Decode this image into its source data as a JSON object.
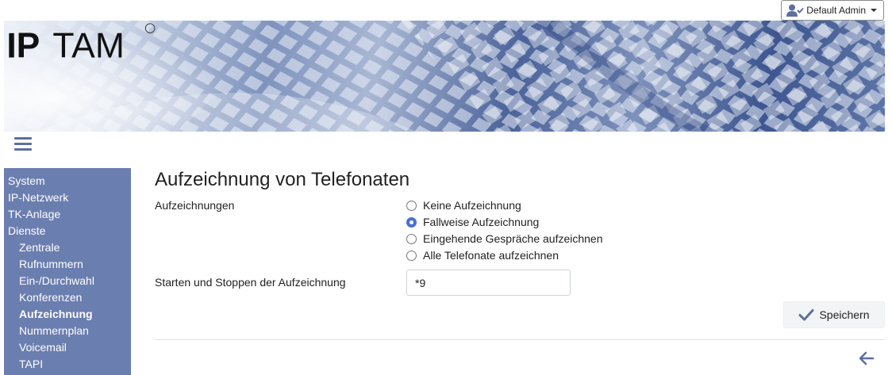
{
  "user_menu": {
    "label": "Default Admin",
    "icon": "user-check-icon"
  },
  "brand": {
    "logo_text": "IPTAM",
    "logo_mark": "®"
  },
  "menu_toggle": {
    "icon": "hamburger-icon"
  },
  "sidebar": {
    "items": [
      {
        "label": "System"
      },
      {
        "label": "IP-Netzwerk"
      },
      {
        "label": "TK-Anlage"
      },
      {
        "label": "Dienste"
      }
    ],
    "sub_items": [
      {
        "label": "Zentrale"
      },
      {
        "label": "Rufnummern"
      },
      {
        "label": "Ein-/Durchwahl"
      },
      {
        "label": "Konferenzen"
      },
      {
        "label": "Aufzeichnung"
      },
      {
        "label": "Nummernplan"
      },
      {
        "label": "Voicemail"
      },
      {
        "label": "TAPI"
      }
    ],
    "active": "Aufzeichnung"
  },
  "page": {
    "title": "Aufzeichnung von Telefonaten",
    "recordings_label": "Aufzeichnungen",
    "options": [
      {
        "label": "Keine Aufzeichnung",
        "checked": false
      },
      {
        "label": "Fallweise Aufzeichnung",
        "checked": true
      },
      {
        "label": "Eingehende Gespräche aufzeichnen",
        "checked": false
      },
      {
        "label": "Alle Telefonate aufzeichnen",
        "checked": false
      }
    ],
    "start_stop_label": "Starten und Stoppen der Aufzeichnung",
    "start_stop_value": "*9",
    "save_label": "Speichern",
    "back_icon": "arrow-left-icon"
  },
  "colors": {
    "sidebar_bg": "#6b7eb0",
    "accent": "#4a6fd6",
    "icon_blue": "#5c6f9e"
  }
}
